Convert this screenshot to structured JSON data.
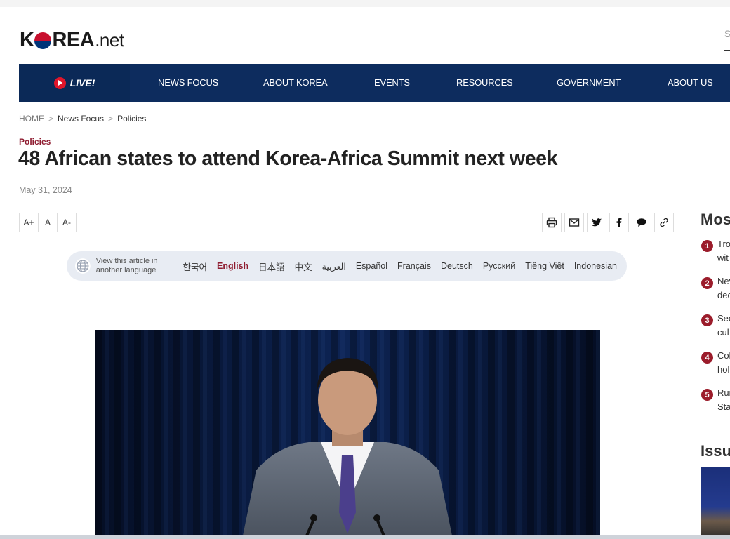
{
  "logo": {
    "k": "K",
    "rest": "REA",
    "dot_net": ".net"
  },
  "search": {
    "placeholder": "S"
  },
  "nav": {
    "live_label": "LIVE!",
    "items": [
      "NEWS FOCUS",
      "ABOUT KOREA",
      "EVENTS",
      "RESOURCES",
      "GOVERNMENT",
      "ABOUT US"
    ]
  },
  "breadcrumb": {
    "home": "HOME",
    "level1": "News Focus",
    "level2": "Policies",
    "sep": ">"
  },
  "article": {
    "category": "Policies",
    "title": "48 African states to attend Korea-Africa Summit next week",
    "date": "May 31, 2024"
  },
  "font_controls": {
    "larger": "A+",
    "default": "A",
    "smaller": "A-"
  },
  "share_icons": [
    "print-icon",
    "email-icon",
    "twitter-icon",
    "facebook-icon",
    "comment-icon",
    "link-icon"
  ],
  "language_bar": {
    "label": "View this article in another language",
    "languages": [
      "한국어",
      "English",
      "日本語",
      "中文",
      "العربية",
      "Español",
      "Français",
      "Deutsch",
      "Русский",
      "Tiếng Việt",
      "Indonesian"
    ],
    "active": "English"
  },
  "sidebar": {
    "most_title": "Mos",
    "ranks": [
      {
        "num": "1",
        "line1": "Tro",
        "line2": "wit"
      },
      {
        "num": "2",
        "line1": "Nev",
        "line2": "dec"
      },
      {
        "num": "3",
        "line1": "Sec",
        "line2": "cul"
      },
      {
        "num": "4",
        "line1": "Col",
        "line2": "hol"
      },
      {
        "num": "5",
        "line1": "Run",
        "line2": "Sta"
      }
    ],
    "issue_title": "Issu"
  },
  "colors": {
    "nav_bg": "#0d2c5e",
    "accent": "#8e1b2f",
    "live_red": "#e0162b"
  }
}
